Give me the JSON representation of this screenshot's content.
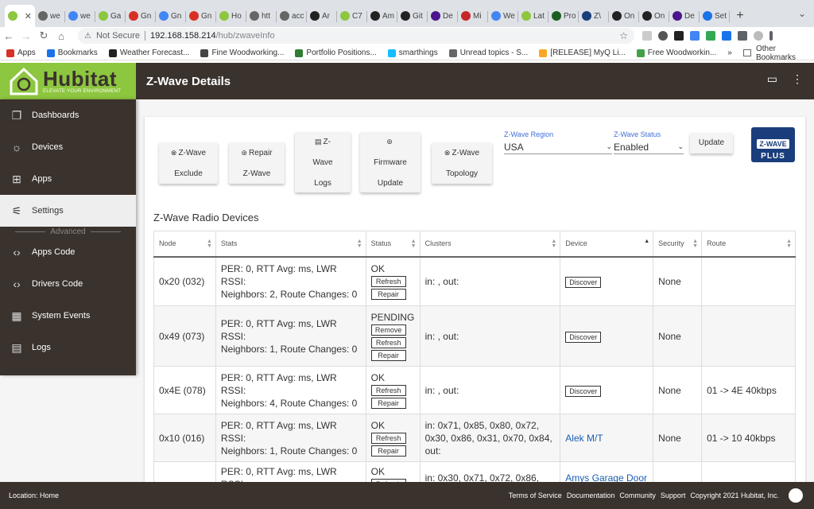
{
  "browser": {
    "tabs": [
      {
        "title": "",
        "color": "#8dc63f",
        "active": true
      },
      {
        "title": "we",
        "color": "#666666"
      },
      {
        "title": "we",
        "color": "#4285f4"
      },
      {
        "title": "Ga",
        "color": "#8dc63f"
      },
      {
        "title": "Gn",
        "color": "#d93025"
      },
      {
        "title": "Gn",
        "color": "#4285f4"
      },
      {
        "title": "Gn",
        "color": "#d93025"
      },
      {
        "title": "Ho",
        "color": "#8dc63f"
      },
      {
        "title": "htt",
        "color": "#666666"
      },
      {
        "title": "acc",
        "color": "#666666"
      },
      {
        "title": "Ar",
        "color": "#222222"
      },
      {
        "title": "C7",
        "color": "#8dc63f"
      },
      {
        "title": "Am",
        "color": "#222222"
      },
      {
        "title": "Git",
        "color": "#222222"
      },
      {
        "title": "De",
        "color": "#4d148c"
      },
      {
        "title": "Mi",
        "color": "#c62828"
      },
      {
        "title": "We",
        "color": "#4285f4"
      },
      {
        "title": "Lat",
        "color": "#8dc63f"
      },
      {
        "title": "Pro",
        "color": "#1b5e20"
      },
      {
        "title": "Z\\",
        "color": "#1a3d7c"
      },
      {
        "title": "On",
        "color": "#222222"
      },
      {
        "title": "On",
        "color": "#222222"
      },
      {
        "title": "De",
        "color": "#4d148c"
      },
      {
        "title": "Set",
        "color": "#1a73e8"
      }
    ],
    "not_secure": "Not Secure",
    "url_host": "192.168.158.214",
    "url_path": "/hub/zwaveInfo",
    "bookmarks": [
      {
        "label": "Apps",
        "color": "#d93025"
      },
      {
        "label": "Bookmarks",
        "color": "#1a73e8"
      },
      {
        "label": "Weather Forecast...",
        "color": "#222222"
      },
      {
        "label": "Fine Woodworking...",
        "color": "#444444"
      },
      {
        "label": "Portfolio Positions...",
        "color": "#2e7d32"
      },
      {
        "label": "smarthings",
        "color": "#15bfff"
      },
      {
        "label": "Unread topics - S...",
        "color": "#666666"
      },
      {
        "label": "[RELEASE] MyQ Li...",
        "color": "#f9a825"
      },
      {
        "label": "Free Woodworkin...",
        "color": "#43a047"
      }
    ],
    "more_bookmarks": "»",
    "other_bookmarks": "Other Bookmarks"
  },
  "app": {
    "brand_name": "Hubitat",
    "brand_tagline": "ELEVATE YOUR ENVIRONMENT",
    "page_title": "Z-Wave Details",
    "colors": {
      "brand_green": "#8dc63f",
      "dark": "#3a322d",
      "link": "#1a5fb4",
      "select_label": "#3f6fd8"
    }
  },
  "sidebar": {
    "items": [
      {
        "label": "Dashboards",
        "icon": "dashboards-icon",
        "glyph": "❐"
      },
      {
        "label": "Devices",
        "icon": "devices-icon",
        "glyph": "☼"
      },
      {
        "label": "Apps",
        "icon": "apps-icon",
        "glyph": "⊞"
      },
      {
        "label": "Settings",
        "icon": "settings-icon",
        "glyph": "⚟"
      },
      {
        "label": "Apps Code",
        "icon": "code-icon",
        "glyph": "‹›"
      },
      {
        "label": "Drivers Code",
        "icon": "code-icon",
        "glyph": "‹›"
      },
      {
        "label": "System Events",
        "icon": "calendar-icon",
        "glyph": "▦"
      },
      {
        "label": "Logs",
        "icon": "logs-icon",
        "glyph": "▤"
      }
    ],
    "active": "Settings",
    "advanced_label": "Advanced"
  },
  "actions": {
    "exclude": [
      "Z-Wave",
      "Exclude"
    ],
    "repair": [
      "Repair",
      "Z-Wave"
    ],
    "logs": [
      "Z-",
      "Wave",
      "Logs"
    ],
    "firmware": [
      "Firmware",
      "Update"
    ],
    "topology": [
      "Z-Wave",
      "Topology"
    ],
    "update": "Update"
  },
  "region": {
    "label": "Z-Wave Region",
    "value": "USA"
  },
  "status": {
    "label": "Z-Wave Status",
    "value": "Enabled"
  },
  "zwave_logo": {
    "text": "Z-WAVE",
    "plus": "PLUS"
  },
  "devices": {
    "title": "Z-Wave Radio Devices",
    "columns": [
      "Node",
      "Stats",
      "Status",
      "Clusters",
      "Device",
      "Security",
      "Route"
    ],
    "sorted_column": "Device",
    "rows": [
      {
        "node": "0x20 (032)",
        "stats": [
          "PER: 0, RTT Avg: ms, LWR RSSI:",
          "Neighbors: 2, Route Changes: 0"
        ],
        "status": "OK",
        "buttons": [
          "Refresh",
          "Repair"
        ],
        "clusters": [
          "in: , out:"
        ],
        "device": "Discover",
        "device_is_button": true,
        "security": "None",
        "route": ""
      },
      {
        "node": "0x49 (073)",
        "stats": [
          "PER: 0, RTT Avg: ms, LWR RSSI:",
          "Neighbors: 1, Route Changes: 0"
        ],
        "status": "PENDING",
        "buttons": [
          "Remove",
          "Refresh",
          "Repair"
        ],
        "clusters": [
          "in: , out:"
        ],
        "device": "Discover",
        "device_is_button": true,
        "security": "None",
        "route": ""
      },
      {
        "node": "0x4E (078)",
        "stats": [
          "PER: 0, RTT Avg: ms, LWR RSSI:",
          "Neighbors: 4, Route Changes: 0"
        ],
        "status": "OK",
        "buttons": [
          "Refresh",
          "Repair"
        ],
        "clusters": [
          "in: , out:"
        ],
        "device": "Discover",
        "device_is_button": true,
        "security": "None",
        "route": "01 -> 4E 40kbps"
      },
      {
        "node": "0x10 (016)",
        "stats": [
          "PER: 0, RTT Avg: ms, LWR RSSI:",
          "Neighbors: 1, Route Changes: 0"
        ],
        "status": "OK",
        "buttons": [
          "Refresh",
          "Repair"
        ],
        "clusters": [
          "in: 0x71, 0x85, 0x80, 0x72,",
          "0x30, 0x86, 0x31, 0x70, 0x84,",
          "out:"
        ],
        "device": "Alek M/T",
        "device_is_button": false,
        "security": "None",
        "route": "01 -> 10 40kbps"
      },
      {
        "node": "",
        "stats": [
          "PER: 0, RTT Avg: ms, LWR RSSI:"
        ],
        "status": "OK",
        "buttons": [
          "Refresh"
        ],
        "clusters": [
          "in: 0x30, 0x71, 0x72, 0x86,"
        ],
        "device": "Amys Garage Door",
        "device_is_button": false,
        "security": "",
        "route": ""
      }
    ]
  },
  "footer": {
    "location": "Location: Home",
    "links": [
      "Terms of Service",
      "Documentation",
      "Community",
      "Support"
    ],
    "copyright": "Copyright 2021 Hubitat, Inc."
  }
}
